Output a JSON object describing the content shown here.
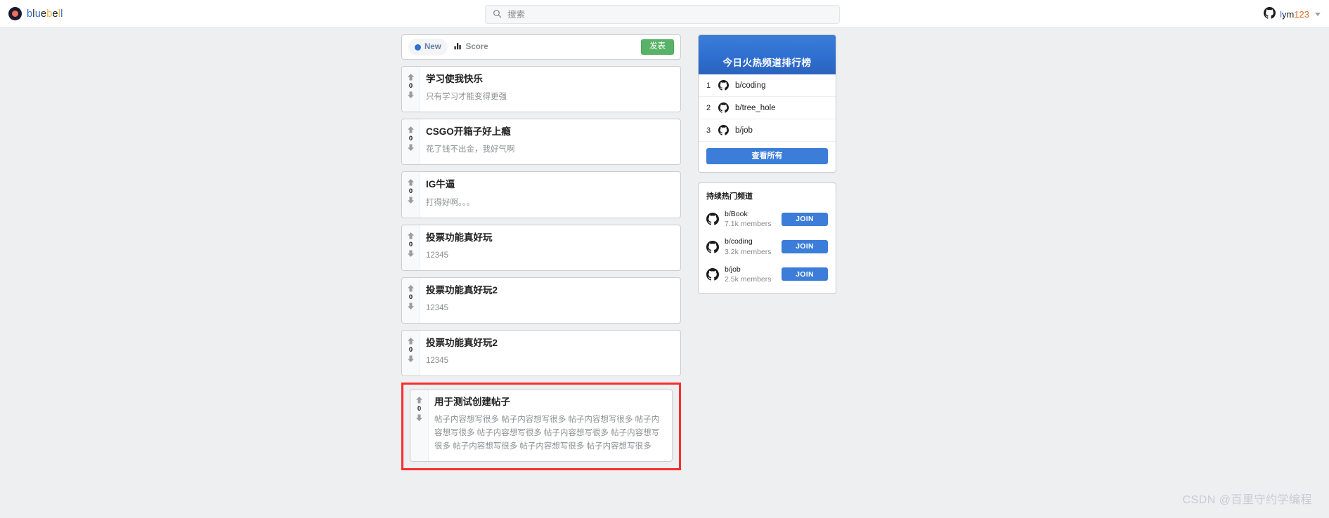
{
  "brand": {
    "name": "bluebell",
    "logo_icon": "bluebell-circle-logo"
  },
  "search": {
    "placeholder": "搜索",
    "value": "",
    "icon": "search-icon"
  },
  "user": {
    "name": "lym123",
    "avatar_icon": "github-octocat-icon",
    "caret_icon": "chevron-down-icon"
  },
  "toolbar": {
    "tabs": [
      {
        "label": "New",
        "icon": "blue-dot-icon",
        "active": true
      },
      {
        "label": "Score",
        "icon": "bar-chart-icon",
        "active": false
      }
    ],
    "publish_label": "发表"
  },
  "posts": [
    {
      "title": "学习使我快乐",
      "content": "只有学习才能变得更强",
      "score": "0",
      "highlighted": false
    },
    {
      "title": "CSGO开箱子好上瘾",
      "content": "花了钱不出金，我好气啊",
      "score": "0",
      "highlighted": false
    },
    {
      "title": "IG牛逼",
      "content": "打得好啊。。。",
      "score": "0",
      "highlighted": false
    },
    {
      "title": "投票功能真好玩",
      "content": "12345",
      "score": "0",
      "highlighted": false
    },
    {
      "title": "投票功能真好玩2",
      "content": "12345",
      "score": "0",
      "highlighted": false
    },
    {
      "title": "投票功能真好玩2",
      "content": "12345",
      "score": "0",
      "highlighted": false
    },
    {
      "title": "用于测试创建帖子",
      "content": "帖子内容想写很多 帖子内容想写很多 帖子内容想写很多 帖子内容想写很多 帖子内容想写很多 帖子内容想写很多 帖子内容想写很多 帖子内容想写很多 帖子内容想写很多 帖子内容想写很多",
      "score": "0",
      "highlighted": true
    }
  ],
  "ranking": {
    "title": "今日火热频道排行榜",
    "rows": [
      {
        "rank": "1",
        "name": "b/coding"
      },
      {
        "rank": "2",
        "name": "b/tree_hole"
      },
      {
        "rank": "3",
        "name": "b/job"
      }
    ],
    "view_all_label": "查看所有"
  },
  "communities": {
    "title": "持续热门频道",
    "rows": [
      {
        "name": "b/Book",
        "members": "7.1k members",
        "join_label": "JOIN"
      },
      {
        "name": "b/coding",
        "members": "3.2k members",
        "join_label": "JOIN"
      },
      {
        "name": "b/job",
        "members": "2.5k members",
        "join_label": "JOIN"
      }
    ]
  },
  "watermark": "CSDN @百里守约学编程",
  "colors": {
    "accent_blue": "#3b7dd8",
    "publish_green": "#58b368",
    "highlight_red": "#fb2c2c",
    "page_bg": "#edeff1"
  }
}
